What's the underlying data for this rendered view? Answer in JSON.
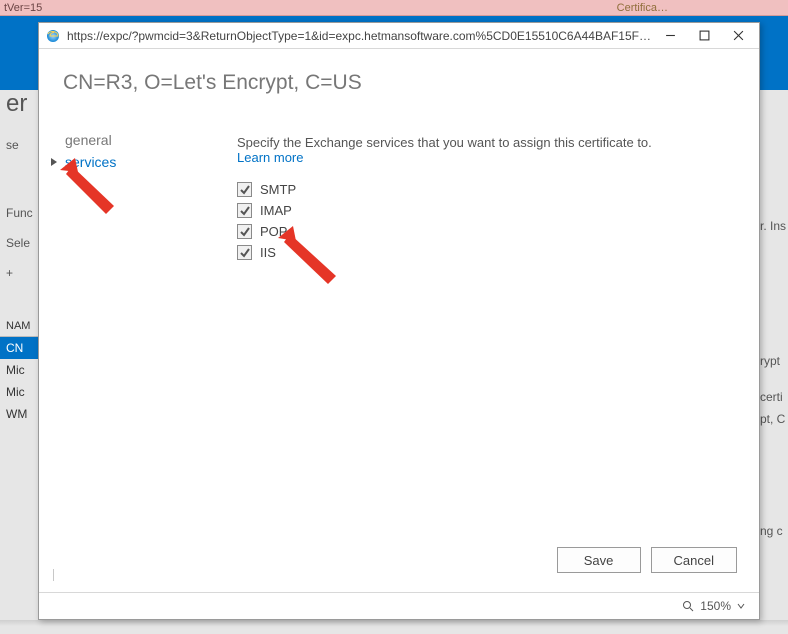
{
  "bg": {
    "topbar_left": "tVer=15",
    "topbar_cert": "Certifica…",
    "panel_head": "er",
    "left_items": [
      "se",
      "Func",
      "Sele"
    ],
    "plus": "+",
    "tbl_head": "NAM",
    "tbl_rows": [
      "CN",
      "Mic",
      "Mic",
      "WM"
    ],
    "right_items": [
      "rypt",
      "certi",
      "pt, C",
      "ng c",
      "r. Ins"
    ]
  },
  "popup": {
    "url": "https://expc/?pwmcid=3&ReturnObjectType=1&id=expc.hetmansoftware.com%5CD0E15510C6A44BAF15F913…",
    "cn_title": "CN=R3, O=Let's Encrypt, C=US",
    "nav": {
      "general": "general",
      "services": "services"
    },
    "hint_prefix": "Specify the Exchange services that you want to assign this certificate to. ",
    "hint_link": "Learn more",
    "checks": [
      {
        "label": "SMTP"
      },
      {
        "label": "IMAP"
      },
      {
        "label": "POP"
      },
      {
        "label": "IIS"
      }
    ],
    "save": "Save",
    "cancel": "Cancel",
    "zoom": "150%"
  }
}
